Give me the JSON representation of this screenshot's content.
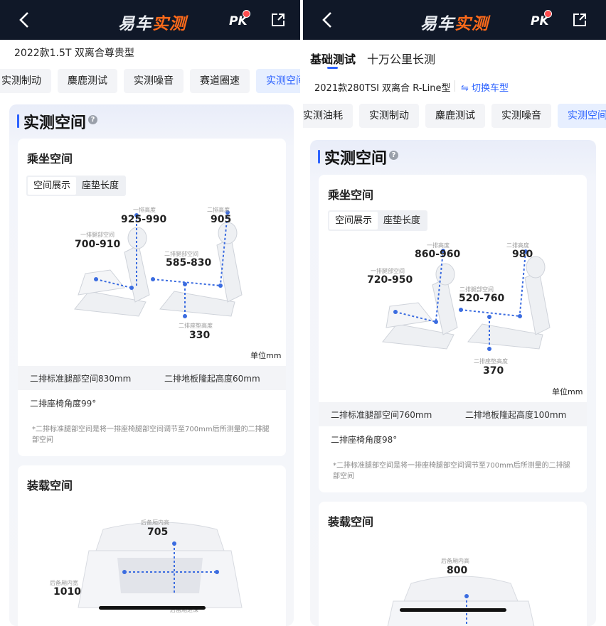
{
  "left": {
    "nav": {
      "logo_pre": "易车",
      "logo_accent": "实测",
      "pk": "PK"
    },
    "model_title": "2022款1.5T 双离合尊贵型",
    "tabs": [
      "实测制动",
      "麋鹿测试",
      "实测噪音",
      "赛道圈速",
      "实测空间"
    ],
    "active_tab": "实测空间",
    "card_title": "实测空间",
    "ride_title": "乘坐空间",
    "segments": [
      "空间展示",
      "座垫长度"
    ],
    "diagram": {
      "front_head_label": "一排高度",
      "front_head": "925-990",
      "front_leg_label": "一排腿部空间",
      "front_leg": "700-910",
      "rear_head_label": "二排高度",
      "rear_head": "905",
      "rear_leg_label": "二排腿部空间",
      "rear_leg": "585-830",
      "rear_cushion_label": "二排座垫高度",
      "rear_cushion": "330",
      "unit": "单位mm"
    },
    "stats": {
      "leg": "二排标准腿部空间830mm",
      "floor": "二排地板隆起高度60mm"
    },
    "angle": "二排座椅角度99°",
    "note": "*二排标准腿部空间是将一排座椅腿部空间调节至700mm后所测量的二排腿部空间",
    "cargo_title": "装载空间",
    "cargo": {
      "height_label": "后备厢内高",
      "height": "705",
      "width_label": "后备厢内宽",
      "width": "1010",
      "depth_label": "后备厢进深"
    }
  },
  "right": {
    "nav": {
      "logo_pre": "易车",
      "logo_accent": "实测",
      "pk": "PK"
    },
    "top_tabs": [
      "基础测试",
      "十万公里长测"
    ],
    "model_title": "2021款280TSI 双离合 R-Line型",
    "switch_label": "切换车型",
    "tabs": [
      "实测油耗",
      "实测制动",
      "麋鹿测试",
      "实测噪音",
      "实测空间"
    ],
    "active_tab": "实测空间",
    "card_title": "实测空间",
    "ride_title": "乘坐空间",
    "segments": [
      "空间展示",
      "座垫长度"
    ],
    "diagram": {
      "front_head_label": "一排高度",
      "front_head": "860-960",
      "front_leg_label": "一排腿部空间",
      "front_leg": "720-950",
      "rear_head_label": "二排高度",
      "rear_head": "980",
      "rear_leg_label": "二排腿部空间",
      "rear_leg": "520-760",
      "rear_cushion_label": "二排座垫高度",
      "rear_cushion": "370",
      "unit": "单位mm"
    },
    "stats": {
      "leg": "二排标准腿部空间760mm",
      "floor": "二排地板隆起高度100mm"
    },
    "angle": "二排座椅角度98°",
    "note": "*二排标准腿部空间是将一排座椅腿部空间调节至700mm后所测量的二排腿部空间",
    "cargo_title": "装载空间",
    "cargo": {
      "height_label": "后备厢内高",
      "height": "800"
    }
  },
  "colors": {
    "accent": "#2d63ff",
    "nav_bg": "#101828",
    "logo_accent": "#ff6a1a",
    "dash": "#3b6ce0"
  }
}
